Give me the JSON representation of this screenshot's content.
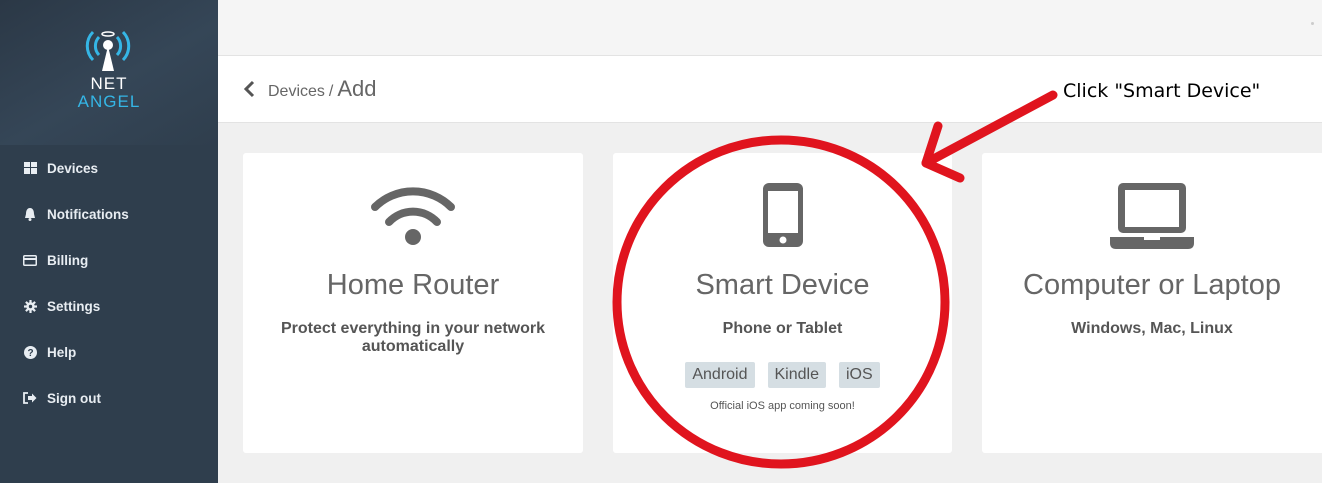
{
  "logo": {
    "line1": "NET",
    "line2": "ANGEL"
  },
  "sidebar": {
    "items": [
      {
        "label": "Devices",
        "icon": "grid-icon"
      },
      {
        "label": "Notifications",
        "icon": "bell-icon"
      },
      {
        "label": "Billing",
        "icon": "credit-card-icon"
      },
      {
        "label": "Settings",
        "icon": "gear-icon"
      },
      {
        "label": "Help",
        "icon": "question-circle-icon"
      },
      {
        "label": "Sign out",
        "icon": "sign-out-icon"
      }
    ]
  },
  "header": {
    "parent": "Devices",
    "separator": "/",
    "current": "Add"
  },
  "cards": [
    {
      "title": "Home Router",
      "subtitle": "Protect everything in your network automatically",
      "icon": "wifi-icon"
    },
    {
      "title": "Smart Device",
      "subtitle": "Phone or Tablet",
      "icon": "smartphone-icon",
      "tags": [
        "Android",
        "Kindle",
        "iOS"
      ],
      "note": "Official iOS app coming soon!"
    },
    {
      "title": "Computer or Laptop",
      "subtitle": "Windows, Mac, Linux",
      "icon": "laptop-icon"
    }
  ],
  "annotation": {
    "text": "Click \"Smart Device\""
  },
  "colors": {
    "sidebar": "#2f3e4d",
    "accent": "#35b6e6",
    "annotation": "#e0141e",
    "tag": "#d5dee3"
  }
}
